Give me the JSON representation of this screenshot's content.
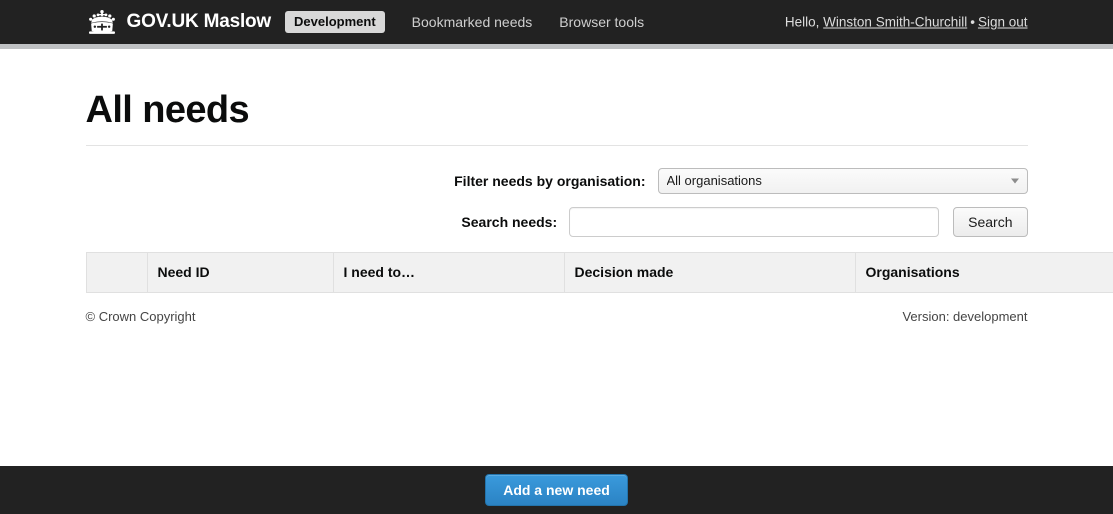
{
  "header": {
    "brand": {
      "icon": "crown-icon",
      "title": "GOV.UK Maslow"
    },
    "env_badge": "Development",
    "nav": [
      {
        "label": "Bookmarked needs"
      },
      {
        "label": "Browser tools"
      }
    ],
    "user": {
      "greeting": "Hello,",
      "name": "Winston Smith-Churchill",
      "separator": "•",
      "sign_out": "Sign out"
    }
  },
  "main": {
    "title": "All needs",
    "filter": {
      "label": "Filter needs by organisation:",
      "selected": "All organisations",
      "arrow_icon": "chevron-down-icon"
    },
    "search": {
      "label": "Search needs:",
      "value": "",
      "placeholder": "",
      "button_label": "Search"
    },
    "table": {
      "columns": [
        "",
        "Need ID",
        "I need to…",
        "Decision made",
        "Organisations"
      ],
      "rows": []
    }
  },
  "footer": {
    "copyright": "© Crown Copyright",
    "version": "Version: development"
  },
  "bottom_bar": {
    "add_need_label": "Add a new need"
  },
  "colors": {
    "header_bg": "#222222",
    "grey_band": "#bfc1c3",
    "accent_blue": "#2b83c4",
    "table_header_bg": "#f1f1f1",
    "page_bg": "#ffffff"
  }
}
